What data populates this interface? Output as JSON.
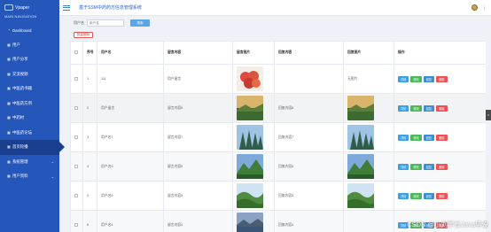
{
  "app": {
    "logo_text": "Vpaper",
    "title": "基于SSM中药药方信息管理系统"
  },
  "sidebar": {
    "heading": "MAIN NAVIGATION",
    "items": [
      {
        "label": "Dashboard",
        "icon": "speedometer-icon"
      },
      {
        "label": "用户",
        "icon": "grid-icon"
      },
      {
        "label": "用户分享",
        "icon": "grid-icon"
      },
      {
        "label": "交流视频",
        "icon": "grid-icon"
      },
      {
        "label": "中医药书籍",
        "icon": "grid-icon"
      },
      {
        "label": "中医药方剂",
        "icon": "grid-icon"
      },
      {
        "label": "中药材",
        "icon": "grid-icon"
      },
      {
        "label": "中医药论坛",
        "icon": "grid-icon"
      },
      {
        "label": "首页轮播",
        "icon": "grid-icon",
        "active": true
      },
      {
        "label": "系统管理",
        "icon": "grid-icon",
        "expandable": true
      },
      {
        "label": "用户资料",
        "icon": "grid-icon",
        "expandable": true
      }
    ]
  },
  "search": {
    "label": "用户名",
    "placeholder": "用户名",
    "button": "搜索"
  },
  "toolbar": {
    "batch_delete": "批量删除"
  },
  "table": {
    "headers": [
      "",
      "序号",
      "用户名",
      "留言内容",
      "留言图片",
      "回复内容",
      "回复图片",
      "操作"
    ],
    "rows": [
      {
        "index": "1",
        "username": "111",
        "content": "用户留言",
        "image": "apples",
        "reply": "",
        "reply_image": "",
        "reply_text_alt": "无图片"
      },
      {
        "index": "2",
        "username": "用户留言",
        "content": "留言内容8",
        "image": "landscape",
        "reply": "回复内容8",
        "reply_image": "landscape"
      },
      {
        "index": "3",
        "username": "用户名7",
        "content": "留言内容7",
        "image": "forest",
        "reply": "回复内容7",
        "reply_image": "forest"
      },
      {
        "index": "4",
        "username": "用户名6",
        "content": "留言内容6",
        "image": "mountain",
        "reply": "回复内容6",
        "reply_image": "mountain"
      },
      {
        "index": "5",
        "username": "用户名5",
        "content": "留言内容5",
        "image": "hills",
        "reply": "回复内容5",
        "reply_image": "hills"
      },
      {
        "index": "6",
        "username": "用户名4",
        "content": "留言内容4",
        "image": "lake",
        "reply": "回复内容4",
        "reply_image": "lake"
      }
    ],
    "ops": {
      "detail": "详情",
      "edit": "修改",
      "comment": "回复",
      "delete": "删除"
    }
  },
  "watermark": "CSDN @小刘学长Java毕设",
  "colors": {
    "sidebar": "#2557bb",
    "sidebar_active": "#1a3f8f",
    "detail": "#3aa0e8",
    "edit": "#4db85a",
    "comment": "#3d8fd1",
    "delete": "#f05252"
  }
}
